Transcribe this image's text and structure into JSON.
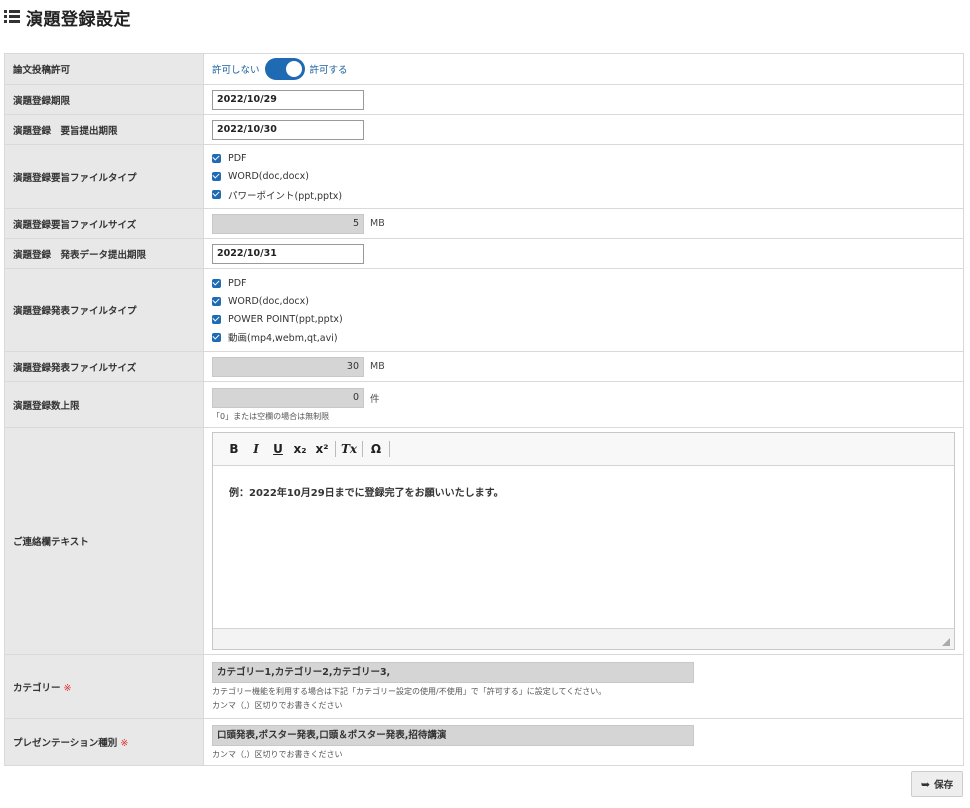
{
  "page": {
    "title": "演題登録設定",
    "title_icon": "list-icon"
  },
  "rows": {
    "paper_submission": {
      "label": "論文投稿許可",
      "off_label": "許可しない",
      "on_label": "許可する",
      "enabled": true
    },
    "registration_deadline": {
      "label": "演題登録期限",
      "value": "2022/10/29"
    },
    "abstract_deadline": {
      "label": "演題登録　要旨提出期限",
      "value": "2022/10/30"
    },
    "abstract_file_types": {
      "label": "演題登録要旨ファイルタイプ",
      "options": [
        "PDF",
        "WORD(doc,docx)",
        "パワーポイント(ppt,pptx)"
      ]
    },
    "abstract_file_size": {
      "label": "演題登録要旨ファイルサイズ",
      "value": "5",
      "unit": "MB"
    },
    "presentation_deadline": {
      "label": "演題登録　発表データ提出期限",
      "value": "2022/10/31"
    },
    "presentation_file_types": {
      "label": "演題登録発表ファイルタイプ",
      "options": [
        "PDF",
        "WORD(doc,docx)",
        "POWER POINT(ppt,pptx)",
        "動画(mp4,webm,qt,avi)"
      ]
    },
    "presentation_file_size": {
      "label": "演題登録発表ファイルサイズ",
      "value": "30",
      "unit": "MB"
    },
    "registration_limit": {
      "label": "演題登録数上限",
      "value": "0",
      "unit": "件",
      "note": "「0」または空欄の場合は無制限"
    },
    "contact_text": {
      "label": "ご連絡欄テキスト",
      "content": "例：2022年10月29日までに登録完了をお願いいたします。",
      "toolbar": [
        "B",
        "I",
        "U",
        "x₂",
        "x²",
        "Tx",
        "Ω"
      ]
    },
    "category": {
      "label": "カテゴリー",
      "required_mark": "※",
      "value": "カテゴリー1,カテゴリー2,カテゴリー3,",
      "note1": "カテゴリー機能を利用する場合は下記「カテゴリー設定の使用/不使用」で「許可する」に設定してください。",
      "note2": "カンマ（,）区切りでお書きください"
    },
    "presentation_type": {
      "label": "プレゼンテーション種別",
      "required_mark": "※",
      "value": "口頭発表,ポスター発表,口頭＆ポスター発表,招待講演",
      "note": "カンマ（,）区切りでお書きください"
    }
  },
  "actions": {
    "save_label": "保存",
    "save_icon": "reply-arrow-icon"
  },
  "colors": {
    "accent": "#1f6bb3",
    "label_bg": "#e8e8e8",
    "required": "#dd3333"
  }
}
